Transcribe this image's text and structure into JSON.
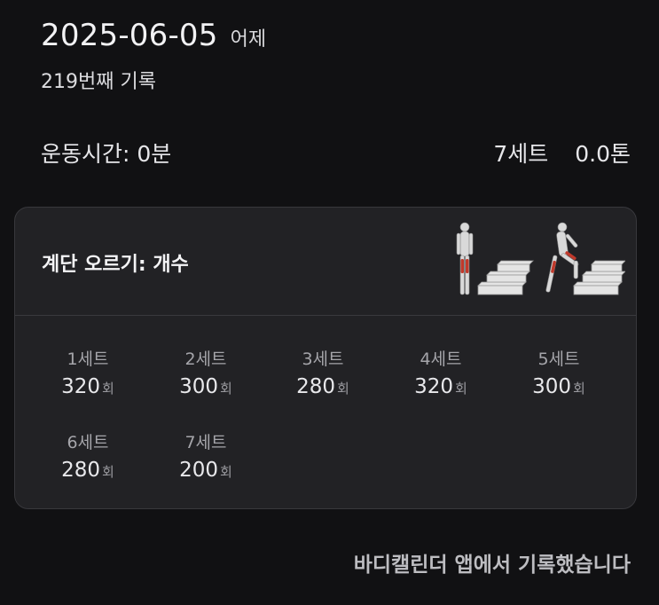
{
  "header": {
    "date": "2025-06-05",
    "relative_day": "어제",
    "record_count": "219번째 기록"
  },
  "summary": {
    "duration": "운동시간: 0분",
    "sets": "7세트",
    "volume": "0.0톤"
  },
  "exercise": {
    "title": "계단 오르기: 개수",
    "illustration_icon": "stair-climb-illustration",
    "sets": [
      {
        "label": "1세트",
        "value": "320",
        "unit": "회"
      },
      {
        "label": "2세트",
        "value": "300",
        "unit": "회"
      },
      {
        "label": "3세트",
        "value": "280",
        "unit": "회"
      },
      {
        "label": "4세트",
        "value": "320",
        "unit": "회"
      },
      {
        "label": "5세트",
        "value": "300",
        "unit": "회"
      },
      {
        "label": "6세트",
        "value": "280",
        "unit": "회"
      },
      {
        "label": "7세트",
        "value": "200",
        "unit": "회"
      }
    ]
  },
  "footer": {
    "note": "바디캘린더 앱에서 기록했습니다"
  },
  "colors": {
    "background": "#111113",
    "card": "#222225",
    "muscle_highlight": "#c0392b"
  }
}
